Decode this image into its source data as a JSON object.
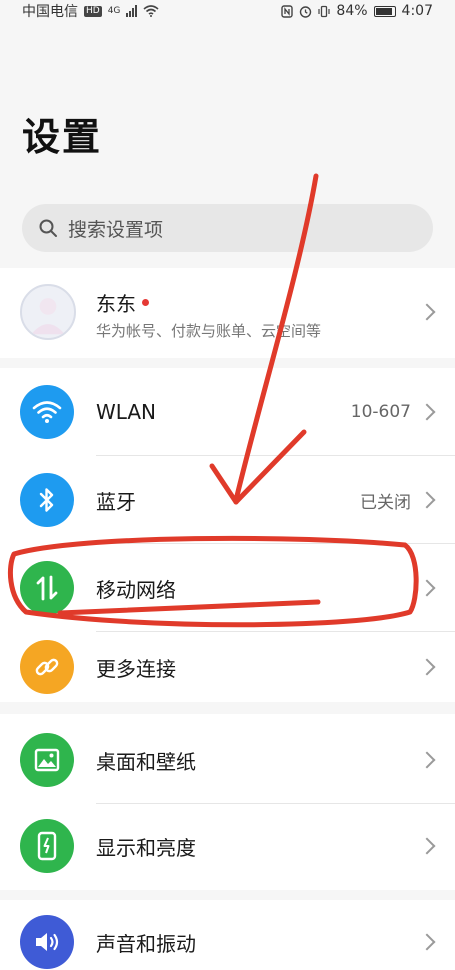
{
  "status_bar": {
    "carrier": "中国电信",
    "hd": "HD",
    "network": "4G",
    "battery": "84%",
    "time": "4:07"
  },
  "page": {
    "title": "设置"
  },
  "search": {
    "placeholder": "搜索设置项"
  },
  "account": {
    "name": "东东",
    "subtitle": "华为帐号、付款与账单、云空间等"
  },
  "items": [
    {
      "label": "WLAN",
      "value": "10-607",
      "icon": "wifi-icon",
      "color": "#1e9bf0"
    },
    {
      "label": "蓝牙",
      "value": "已关闭",
      "icon": "bluetooth-icon",
      "color": "#1e9bf0"
    },
    {
      "label": "移动网络",
      "value": "",
      "icon": "mobile-data-icon",
      "color": "#2fb54d"
    },
    {
      "label": "更多连接",
      "value": "",
      "icon": "link-icon",
      "color": "#f5a623"
    },
    {
      "label": "桌面和壁纸",
      "value": "",
      "icon": "wallpaper-icon",
      "color": "#2fb54d"
    },
    {
      "label": "显示和亮度",
      "value": "",
      "icon": "display-icon",
      "color": "#2fb54d"
    },
    {
      "label": "声音和振动",
      "value": "",
      "icon": "sound-icon",
      "color": "#3f5bd6"
    }
  ],
  "colors": {
    "annotation_red": "#e03a2a",
    "notification_dot": "#e53935"
  }
}
